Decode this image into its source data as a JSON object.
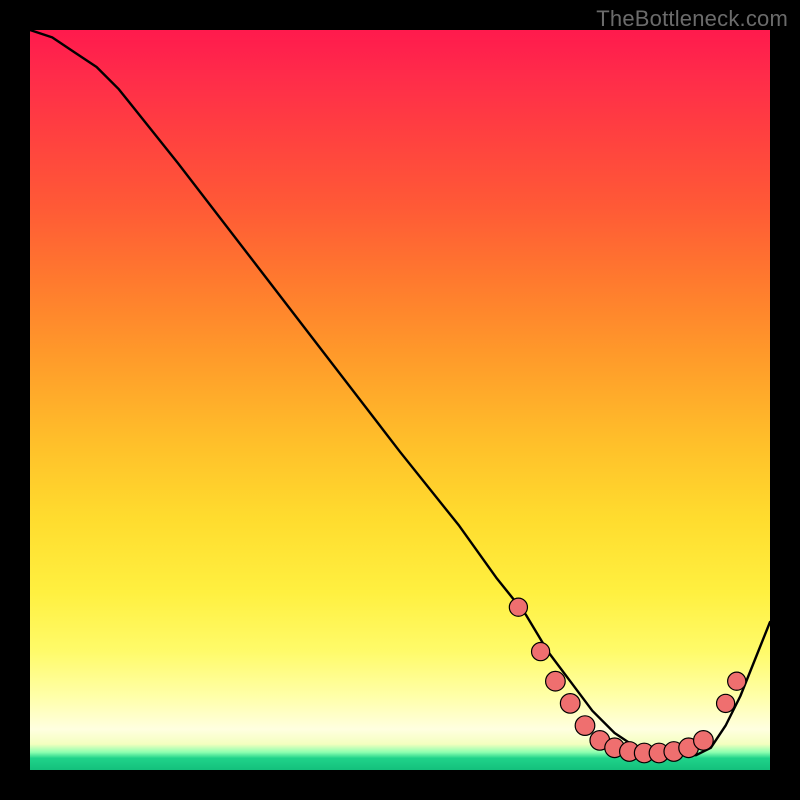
{
  "watermark": "TheBottleneck.com",
  "colors": {
    "curve_stroke": "#000000",
    "marker_fill": "#ef6f6f",
    "marker_stroke": "#000000"
  },
  "chart_data": {
    "type": "line",
    "title": "",
    "xlabel": "",
    "ylabel": "",
    "xlim": [
      0,
      100
    ],
    "ylim": [
      0,
      100
    ],
    "grid": false,
    "legend": false,
    "note": "Axes unlabeled; values are estimated positions as percent of the plot area (0=left/bottom, 100=right/top).",
    "series": [
      {
        "name": "bottleneck-curve",
        "x": [
          0,
          3,
          6,
          9,
          12,
          20,
          30,
          40,
          50,
          58,
          63,
          67,
          70,
          73,
          76,
          79,
          82,
          84,
          86,
          88,
          90,
          92,
          94,
          96,
          98,
          100
        ],
        "y": [
          100,
          99,
          97,
          95,
          92,
          82,
          69,
          56,
          43,
          33,
          26,
          21,
          16,
          12,
          8,
          5,
          3,
          2,
          2,
          2,
          2,
          3,
          6,
          10,
          15,
          20
        ]
      }
    ],
    "markers": {
      "name": "recommended-range",
      "comment": "Salmon dots along the valley of the curve.",
      "points": [
        {
          "x": 66,
          "y": 22,
          "r": 1.1
        },
        {
          "x": 69,
          "y": 16,
          "r": 1.1
        },
        {
          "x": 71,
          "y": 12,
          "r": 1.3
        },
        {
          "x": 73,
          "y": 9,
          "r": 1.3
        },
        {
          "x": 75,
          "y": 6,
          "r": 1.3
        },
        {
          "x": 77,
          "y": 4,
          "r": 1.3
        },
        {
          "x": 79,
          "y": 3,
          "r": 1.3
        },
        {
          "x": 81,
          "y": 2.5,
          "r": 1.3
        },
        {
          "x": 83,
          "y": 2.3,
          "r": 1.3
        },
        {
          "x": 85,
          "y": 2.3,
          "r": 1.3
        },
        {
          "x": 87,
          "y": 2.5,
          "r": 1.3
        },
        {
          "x": 89,
          "y": 3,
          "r": 1.3
        },
        {
          "x": 91,
          "y": 4,
          "r": 1.3
        },
        {
          "x": 94,
          "y": 9,
          "r": 1.1
        },
        {
          "x": 95.5,
          "y": 12,
          "r": 1.1
        }
      ]
    }
  }
}
